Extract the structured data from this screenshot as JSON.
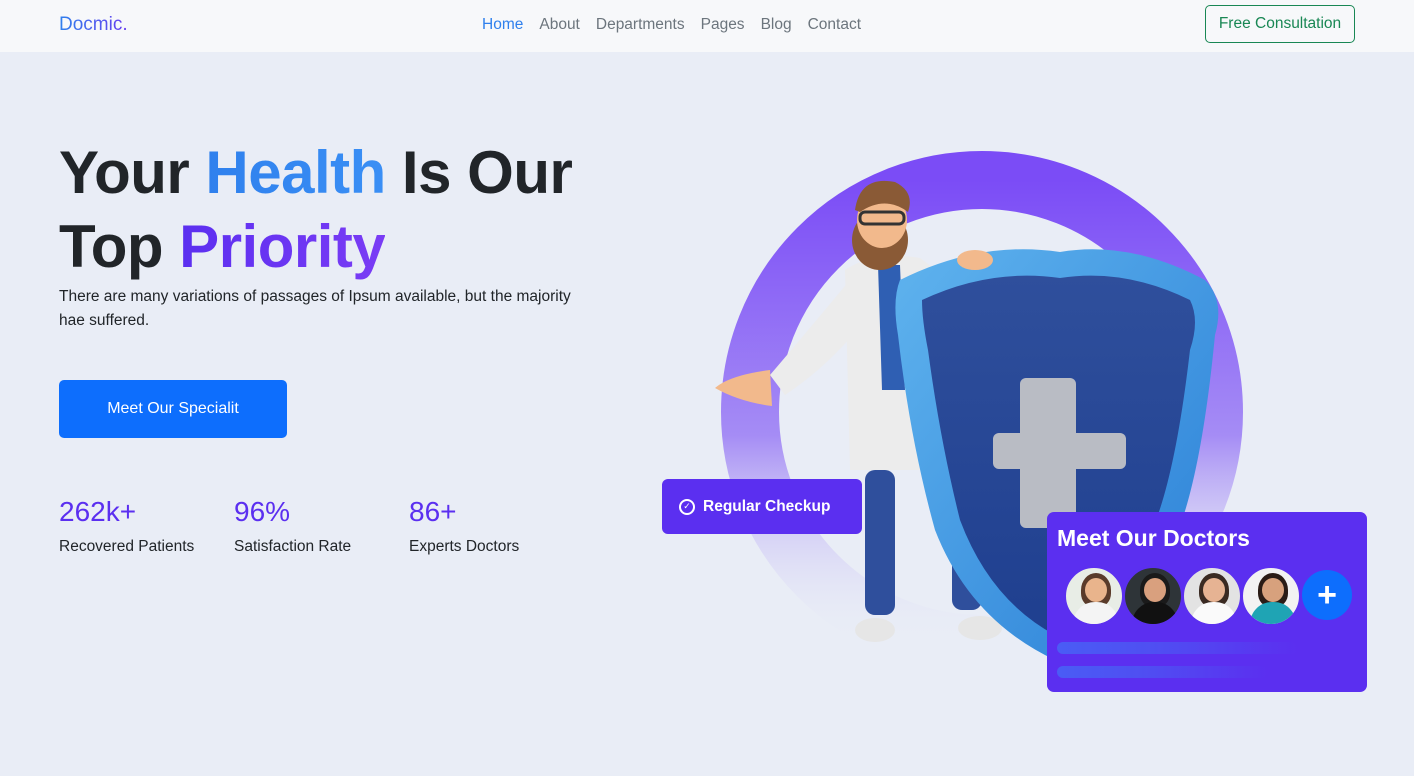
{
  "nav": {
    "brand": "Docmic.",
    "links": [
      "Home",
      "About",
      "Departments",
      "Pages",
      "Blog",
      "Contact"
    ],
    "active_link": "Home",
    "cta": "Free Consultation"
  },
  "hero": {
    "title_part1": "Your ",
    "title_highlight1": "Health",
    "title_part2": " Is Our Top ",
    "title_highlight2": "Priority",
    "subtitle": "There are many variations of passages of Ipsum available, but the majority hae suffered.",
    "button": "Meet Our Specialit"
  },
  "stats": [
    {
      "value": "262k+",
      "label": "Recovered Patients"
    },
    {
      "value": "96%",
      "label": "Satisfaction Rate"
    },
    {
      "value": "86+",
      "label": "Experts Doctors"
    }
  ],
  "checkup_card": {
    "label": "Regular Checkup",
    "icon": "check-circle-icon"
  },
  "doctors_card": {
    "title": "Meet Our Doctors",
    "plus": "+",
    "avatars": [
      "doctor-avatar-1",
      "doctor-avatar-2",
      "doctor-avatar-3",
      "doctor-avatar-4"
    ]
  },
  "colors": {
    "primary_blue": "#0d6efd",
    "accent_purple": "#5b2ff0",
    "link_blue": "#2f80ed",
    "green_outline": "#198754",
    "background": "#e9edf6"
  }
}
